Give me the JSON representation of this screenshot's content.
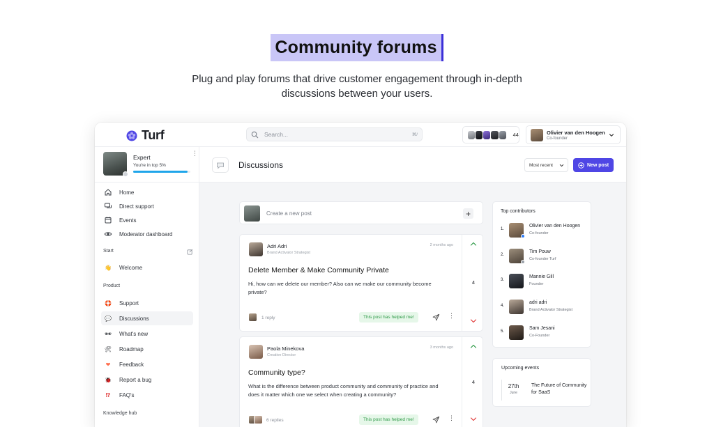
{
  "hero": {
    "title": "Community forums",
    "subtitle": "Plug and play forums that drive customer engagement through in-depth discussions between your users."
  },
  "topbar": {
    "logo_text": "Turf",
    "search_placeholder": "Search...",
    "search_shortcut": "⌘/",
    "member_count": "44",
    "user_name": "Olivier van den Hoogen",
    "user_role": "Co-founder"
  },
  "profile": {
    "level": "Expert",
    "rank_text": "You're in top 5%",
    "progress": 0.95
  },
  "sidebar": {
    "main_items": [
      {
        "label": "Home",
        "icon": "home-icon"
      },
      {
        "label": "Direct support",
        "icon": "chat-icon"
      },
      {
        "label": "Events",
        "icon": "calendar-icon"
      },
      {
        "label": "Moderator dashboard",
        "icon": "eye-icon"
      }
    ],
    "start_label": "Start",
    "start_items": [
      {
        "label": "Welcome",
        "icon": "wave-emoji-icon"
      }
    ],
    "product_label": "Product",
    "product_items": [
      {
        "label": "Support",
        "icon": "support-emoji-icon"
      },
      {
        "label": "Discussions",
        "icon": "speech-bubble-icon"
      },
      {
        "label": "What's new",
        "icon": "sunglasses-emoji-icon"
      },
      {
        "label": "Roadmap",
        "icon": "tools-emoji-icon"
      },
      {
        "label": "Feedback",
        "icon": "heart-emoji-icon"
      },
      {
        "label": "Report a bug",
        "icon": "bug-emoji-icon"
      },
      {
        "label": "FAQ's",
        "icon": "question-emoji-icon"
      }
    ],
    "knowledge_label": "Knowledge hub"
  },
  "main": {
    "title": "Discussions",
    "sort_label": "Most recent",
    "new_post_label": "New post",
    "create_placeholder": "Create a new post"
  },
  "posts": [
    {
      "author": "Adri Adri",
      "role": "Brand Activator Strategist",
      "time": "2 months ago",
      "title": "Delete Member & Make Community Private",
      "body": "Hi, how can we delete our member? Also can we make our community become private?",
      "replies": "1 reply",
      "helped": "This post has helped me!",
      "votes": "4"
    },
    {
      "author": "Paola Minekova",
      "role": "Creative Director",
      "time": "3 months ago",
      "title": "Community type?",
      "body": "What is the difference between product community and community of practice and does it matter which one we select when creating a community?",
      "replies": "6 replies",
      "helped": "This post has helped me!",
      "votes": "4"
    }
  ],
  "top_contributors": {
    "title": "Top contributors",
    "items": [
      {
        "rank": "1.",
        "name": "Olivier van den Hoogen",
        "role": "Co-founder"
      },
      {
        "rank": "2.",
        "name": "Tim Pouw",
        "role": "Co-founder Turf"
      },
      {
        "rank": "3.",
        "name": "Mannie Gill",
        "role": "Founder"
      },
      {
        "rank": "4.",
        "name": "adri adri",
        "role": "Brand Activator Strategist"
      },
      {
        "rank": "5.",
        "name": "Sam Jesani",
        "role": "Co-Founder"
      }
    ]
  },
  "events": {
    "title": "Upcoming events",
    "day": "27th",
    "month": "June",
    "name": "The Future of Community for SaaS"
  },
  "colors": {
    "accent": "#4f46e5",
    "hero_highlight": "#c9c6f7",
    "progress": "#1fa5ea",
    "helped_bg": "#e6f7e9",
    "helped_text": "#2f9a48",
    "vote_up": "#2f9a48",
    "vote_down": "#e03b3b"
  }
}
